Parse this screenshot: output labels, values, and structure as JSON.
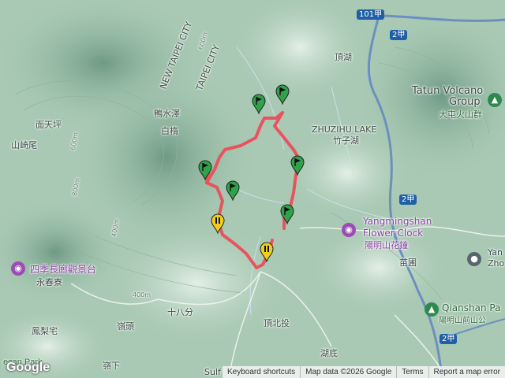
{
  "map": {
    "place_labels": {
      "new_taipei_city": "NEW TAIPEI CITY",
      "taipei_city": "TAIPEI CITY",
      "mian_tian_ping": "面天坪",
      "shan_qi_wei": "山崎尾",
      "ya_shui_ze": "鴨水澤",
      "bai_tang": "白楕",
      "ding_hu": "頂湖",
      "zhuzihu_lake_en": "ZHUZIHU LAKE",
      "zhuzihu_lake_zh": "竹子湖",
      "tatun_volcano_en1": "Tatun Volcano",
      "tatun_volcano_en2": "Group",
      "tatun_volcano_zh": "大屯火山群",
      "yangmingshan_clock_en1": "Yangmingshan",
      "yangmingshan_clock_en2": "Flower Clock",
      "yangmingshan_clock_zh": "陽明山花鐘",
      "siji_changlang": "四季長廊觀景台",
      "yong_chun_liao": "永春寮",
      "shi_ba_fen": "十八分",
      "ding_bei_tou": "頂北投",
      "miao_pu": "苗圃",
      "feng_li_zhai": "鳳梨宅",
      "ling_tou": "嶺頭",
      "hu_di": "湖底",
      "ling_xia": "嶺下",
      "qianshan_en": "Qianshan Pa",
      "qianshan_zh": "陽明山前山公",
      "yang_zho": "Yan Zho",
      "sulf": "Sulf",
      "park": "ecan Park"
    },
    "road_shields": {
      "r101a": "101甲",
      "r2a_top": "2甲",
      "r2a_mid": "2甲",
      "r2a_bottom": "2甲"
    },
    "contour_labels": [
      "600m",
      "800m",
      "400m",
      "400m",
      "600m"
    ],
    "route_color": "#e8545e",
    "marker_colors": {
      "green": "#2fa24a",
      "yellow": "#f2cc1a"
    },
    "markers": [
      {
        "name": "flag-marker-1",
        "kind": "flag",
        "icon": "flag-icon"
      },
      {
        "name": "flag-marker-2",
        "kind": "flag",
        "icon": "flag-icon"
      },
      {
        "name": "flag-marker-3",
        "kind": "flag",
        "icon": "flag-icon"
      },
      {
        "name": "flag-marker-4",
        "kind": "flag",
        "icon": "flag-icon"
      },
      {
        "name": "flag-marker-5",
        "kind": "flag",
        "icon": "flag-icon"
      },
      {
        "name": "flag-marker-6",
        "kind": "flag",
        "icon": "flag-icon"
      },
      {
        "name": "pause-marker-1",
        "kind": "pause",
        "icon": "pause-icon"
      },
      {
        "name": "pause-marker-2",
        "kind": "pause",
        "icon": "pause-icon"
      }
    ]
  },
  "footer": {
    "google_logo": "Google",
    "keyboard_shortcuts": "Keyboard shortcuts",
    "map_data": "Map data ©2026 Google",
    "terms": "Terms",
    "report": "Report a map error"
  }
}
